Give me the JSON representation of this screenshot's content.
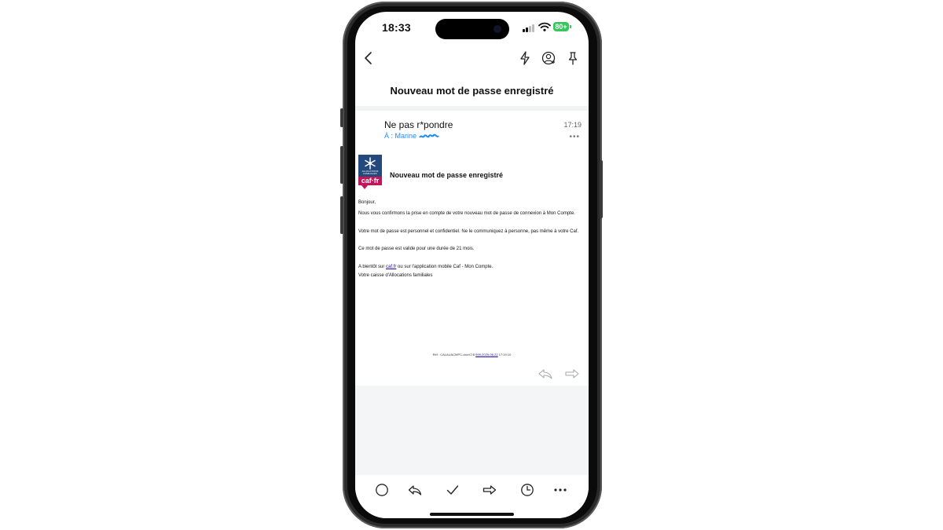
{
  "status_bar": {
    "time": "18:33",
    "battery": "80+"
  },
  "email": {
    "subject": "Nouveau mot de passe enregistré",
    "sender": "Ne pas r*pondre",
    "to_prefix": "À : Marine",
    "time": "17:19",
    "more": "•••"
  },
  "logo": {
    "brand": "caf·fr",
    "tagline": "ALLOCATIONS FAMILIALES"
  },
  "body": {
    "title": "Nouveau mot de passe enregistré",
    "greeting": "Bonjour,",
    "p1": "Nous vous confirmons la prise en compte de votre nouveau mot de passe de connexion à Mon Compte.",
    "p2": "Votre mot de passe est personnel et confidentiel. Ne le communiquez à personne, pas même à votre Caf.",
    "p3": "Ce mot de passe est valide pour une durée de 21 mois.",
    "p4_before": "A bientôt sur ",
    "p4_link": "caf.fr",
    "p4_after": " ou sur l'application mobile Caf - Mon Compte.",
    "sign": "Votre caisse d'Allocations familiales",
    "ref_prefix": "Réf : CALAUACMPC-docV2.8",
    "ref_link": "999-2025-06-22",
    "ref_time": "17:19:10"
  },
  "colors": {
    "accent": "#1a8cff",
    "caf_blue": "#24497d",
    "caf_pink": "#c4145a",
    "battery": "#34c759"
  },
  "icons": {
    "nav": [
      "back-chevron-icon",
      "lightning-icon",
      "add-contact-icon",
      "pin-icon"
    ],
    "toolbar": [
      "circle-icon",
      "reply-icon",
      "checkmark-icon",
      "forward-icon",
      "clock-icon",
      "more-icon"
    ]
  }
}
